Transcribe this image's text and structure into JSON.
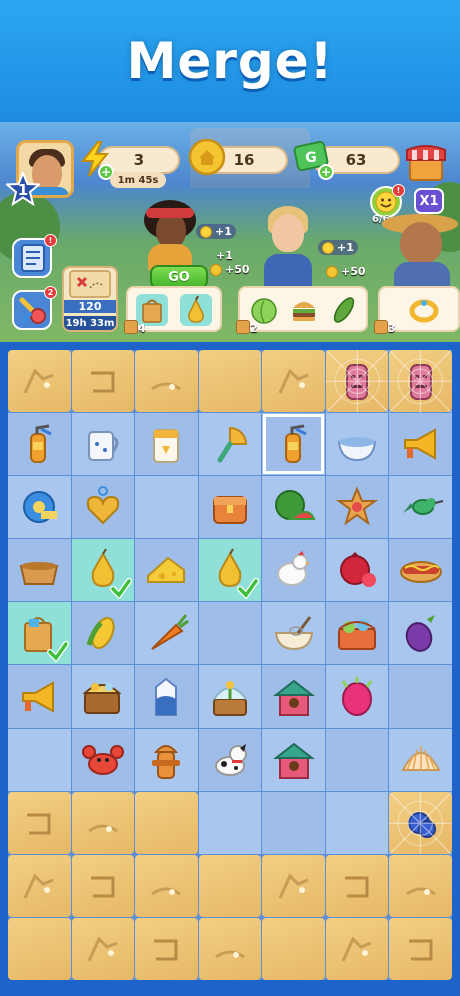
{
  "banner": {
    "title": "Merge!"
  },
  "player": {
    "level": "1"
  },
  "resources": {
    "energy": {
      "value": "3",
      "timer": "1m 45s"
    },
    "coins": {
      "value": "16"
    },
    "cash": {
      "value": "63"
    }
  },
  "booster": {
    "energy_progress": "6/6",
    "multiplier": "X1"
  },
  "side": {
    "notebook_badge": "!",
    "tools_badge": "2"
  },
  "quest_map": {
    "count": "120",
    "time": "19h 33m"
  },
  "customers": [
    {
      "name": "woman-curly-hair",
      "rewards": [
        "+1",
        "+1",
        "+50"
      ],
      "button": "GO",
      "order_count": "4",
      "order_items": [
        "shopping-bag-icon",
        "pear-icon"
      ]
    },
    {
      "name": "woman-chef",
      "rewards": [
        "+1",
        "+50"
      ],
      "order_count": "2",
      "order_items": [
        "cabbage-icon",
        "burger-icon",
        "cucumber-icon"
      ]
    },
    {
      "name": "farmer-man",
      "order_count": "3",
      "order_items": [
        "bracelet-icon"
      ]
    }
  ],
  "board": {
    "rows": [
      [
        "sand",
        "sand",
        "sand",
        "sand",
        "sand",
        "totem-web",
        "totem-web"
      ],
      [
        "extinguisher",
        "mug",
        "flour-bag",
        "fan",
        "extinguisher-selected",
        "bowl",
        "megaphone"
      ],
      [
        "tape",
        "heart-pendant",
        "empty",
        "chest",
        "watermelon",
        "cookie",
        "hummingbird"
      ],
      [
        "basket",
        "pear-check",
        "cheese",
        "pear-check",
        "chicken",
        "pomegranate",
        "hotdog"
      ],
      [
        "bag-check",
        "corn",
        "carrot",
        "empty",
        "whisk-bowl",
        "veggie-basket",
        "eggplant"
      ],
      [
        "megaphone",
        "treasure-chest",
        "milk",
        "plant-box",
        "house",
        "dragonfruit",
        "empty"
      ],
      [
        "empty",
        "crab",
        "hydrant",
        "dog",
        "house",
        "empty",
        "shell"
      ],
      [
        "sand",
        "sand",
        "sand",
        "empty",
        "empty",
        "empty",
        "blueberry-web"
      ],
      [
        "sand",
        "sand",
        "sand",
        "sand",
        "sand",
        "sand",
        "sand"
      ],
      [
        "sand",
        "sand",
        "sand",
        "sand",
        "sand",
        "sand",
        "sand"
      ]
    ]
  },
  "colors": {
    "banner": "#2aa7f2",
    "board": "#5b8fd8",
    "sand": "#eac47a",
    "go": "#44b52c"
  }
}
